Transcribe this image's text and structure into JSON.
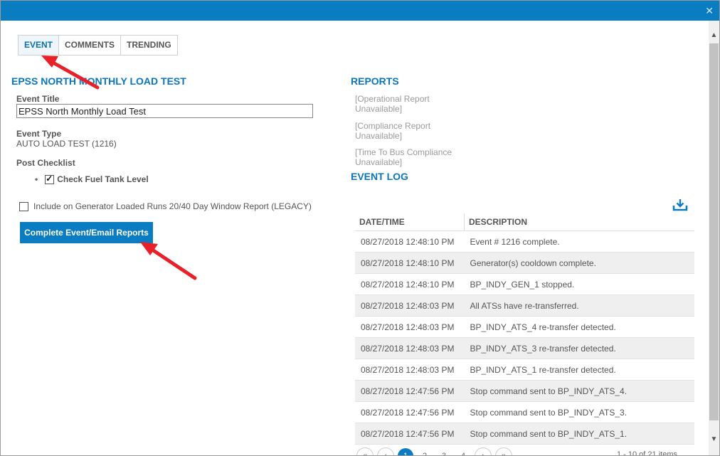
{
  "tabs": [
    "EVENT",
    "COMMENTS",
    "TRENDING"
  ],
  "left": {
    "section_title": "EPSS NORTH MONTHLY LOAD TEST",
    "event_title_label": "Event Title",
    "event_title_value": "EPSS North Monthly Load Test",
    "event_type_label": "Event Type",
    "event_type_value": "AUTO LOAD TEST (1216)",
    "post_checklist_label": "Post Checklist",
    "checklist_item": "Check Fuel Tank Level",
    "legacy_label": "Include on Generator Loaded Runs 20/40 Day Window Report (LEGACY)",
    "complete_button": "Complete Event/Email Reports"
  },
  "reports": {
    "title": "REPORTS",
    "items": [
      "[Operational Report Unavailable]",
      "[Compliance Report Unavailable]",
      "[Time To Bus Compliance Unavailable]"
    ]
  },
  "event_log": {
    "title": "EVENT LOG",
    "columns": [
      "DATE/TIME",
      "DESCRIPTION"
    ],
    "rows": [
      [
        "08/27/2018 12:48:10 PM",
        "Event # 1216 complete."
      ],
      [
        "08/27/2018 12:48:10 PM",
        "Generator(s) cooldown complete."
      ],
      [
        "08/27/2018 12:48:10 PM",
        "BP_INDY_GEN_1 stopped."
      ],
      [
        "08/27/2018 12:48:03 PM",
        "All ATSs have re-transferred."
      ],
      [
        "08/27/2018 12:48:03 PM",
        "BP_INDY_ATS_4 re-transfer detected."
      ],
      [
        "08/27/2018 12:48:03 PM",
        "BP_INDY_ATS_3 re-transfer detected."
      ],
      [
        "08/27/2018 12:48:03 PM",
        "BP_INDY_ATS_1 re-transfer detected."
      ],
      [
        "08/27/2018 12:47:56 PM",
        "Stop command sent to BP_INDY_ATS_4."
      ],
      [
        "08/27/2018 12:47:56 PM",
        "Stop command sent to BP_INDY_ATS_3."
      ],
      [
        "08/27/2018 12:47:56 PM",
        "Stop command sent to BP_INDY_ATS_1."
      ]
    ],
    "pager": {
      "pages": [
        "1",
        "2",
        "3",
        "4"
      ],
      "items_count": "1 - 10 of 21 items"
    }
  },
  "colors": {
    "accent": "#0a7cc1",
    "annotation_arrow": "#e8202a"
  },
  "icons": {
    "close": "close-icon",
    "download": "download-icon"
  }
}
